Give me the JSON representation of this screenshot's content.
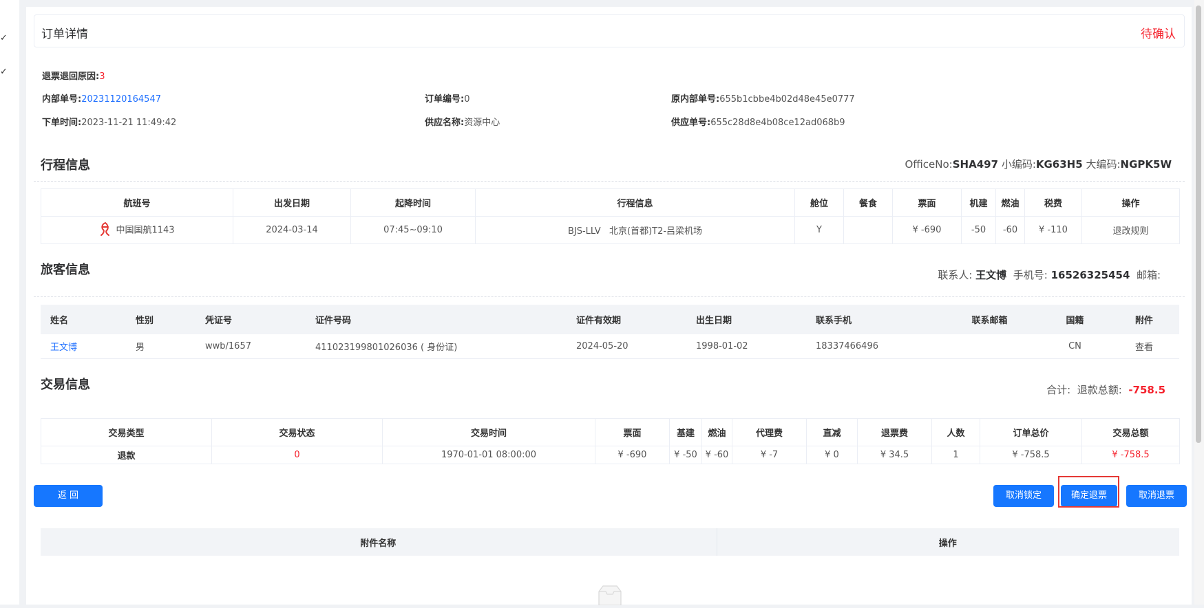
{
  "header": {
    "title": "订单详情",
    "status": "待确认"
  },
  "order": {
    "reason_label": "退票退回原因:",
    "reason_value": "3",
    "internal_no_label": "内部单号:",
    "internal_no_value": "20231120164547",
    "order_no_label": "订单编号:",
    "order_no_value": "0",
    "orig_internal_label": "原内部单号:",
    "orig_internal_value": "655b1cbbe4b02d48e45e0777",
    "time_label": "下单时间:",
    "time_value": "2023-11-21 11:49:42",
    "supplier_label": "供应名称:",
    "supplier_value": "资源中心",
    "supplier_no_label": "供应单号:",
    "supplier_no_value": "655c28d8e4b08ce12ad068b9"
  },
  "itinerary": {
    "title": "行程信息",
    "office_label": "OfficeNo:",
    "office_value": "SHA497",
    "small_code_label": "小编码:",
    "small_code_value": "KG63H5",
    "big_code_label": "大编码:",
    "big_code_value": "NGPK5W",
    "columns": [
      "航班号",
      "出发日期",
      "起降时间",
      "行程信息",
      "舱位",
      "餐食",
      "票面",
      "机建",
      "燃油",
      "税费",
      "操作"
    ],
    "row": {
      "flight": "中国国航1143",
      "date": "2024-03-14",
      "time": "07:45~09:10",
      "route": "BJS-LLV   北京(首都)T2-吕梁机场",
      "cabin": "Y",
      "meal": "",
      "fare": "¥ -690",
      "airport_fee": "-50",
      "fuel": "-60",
      "tax": "¥ -110",
      "action": "退改规则"
    }
  },
  "passenger": {
    "title": "旅客信息",
    "contact_label": "联系人:",
    "contact_value": "王文博",
    "phone_label": "手机号:",
    "phone_value": "16526325454",
    "email_label": "邮箱:",
    "columns": [
      "姓名",
      "性别",
      "凭证号",
      "证件号码",
      "证件有效期",
      "出生日期",
      "联系手机",
      "联系邮箱",
      "国籍",
      "附件"
    ],
    "row": {
      "name": "王文博",
      "gender": "男",
      "voucher": "wwb/1657",
      "id_no": "411023199801026036 ( 身份证)",
      "id_expiry": "2024-05-20",
      "birth": "1998-01-02",
      "mobile": "18337466496",
      "email": "",
      "nationality": "CN",
      "attachment": "查看"
    }
  },
  "transaction": {
    "title": "交易信息",
    "total_label": "合计:",
    "refund_total_label": "退款总额:",
    "refund_total_value": "-758.5",
    "columns": [
      "交易类型",
      "交易状态",
      "交易时间",
      "票面",
      "基建",
      "燃油",
      "代理费",
      "直减",
      "退票费",
      "人数",
      "订单总价",
      "交易总额"
    ],
    "row": {
      "type": "退款",
      "status": "0",
      "time": "1970-01-01 08:00:00",
      "fare": "¥ -690",
      "base": "¥ -50",
      "fuel": "¥ -60",
      "agent_fee": "¥ -7",
      "discount": "¥ 0",
      "refund_fee": "¥ 34.5",
      "count": "1",
      "order_total": "¥ -758.5",
      "trade_total": "¥ -758.5"
    }
  },
  "buttons": {
    "back": "返 回",
    "cancel_lock": "取消锁定",
    "confirm_refund": "确定退票",
    "cancel_refund": "取消退票"
  },
  "attachments": {
    "columns": [
      "附件名称",
      "操作"
    ]
  },
  "colors": {
    "primary": "#1677ff",
    "danger": "#f5222d",
    "link": "#1e6fff"
  }
}
